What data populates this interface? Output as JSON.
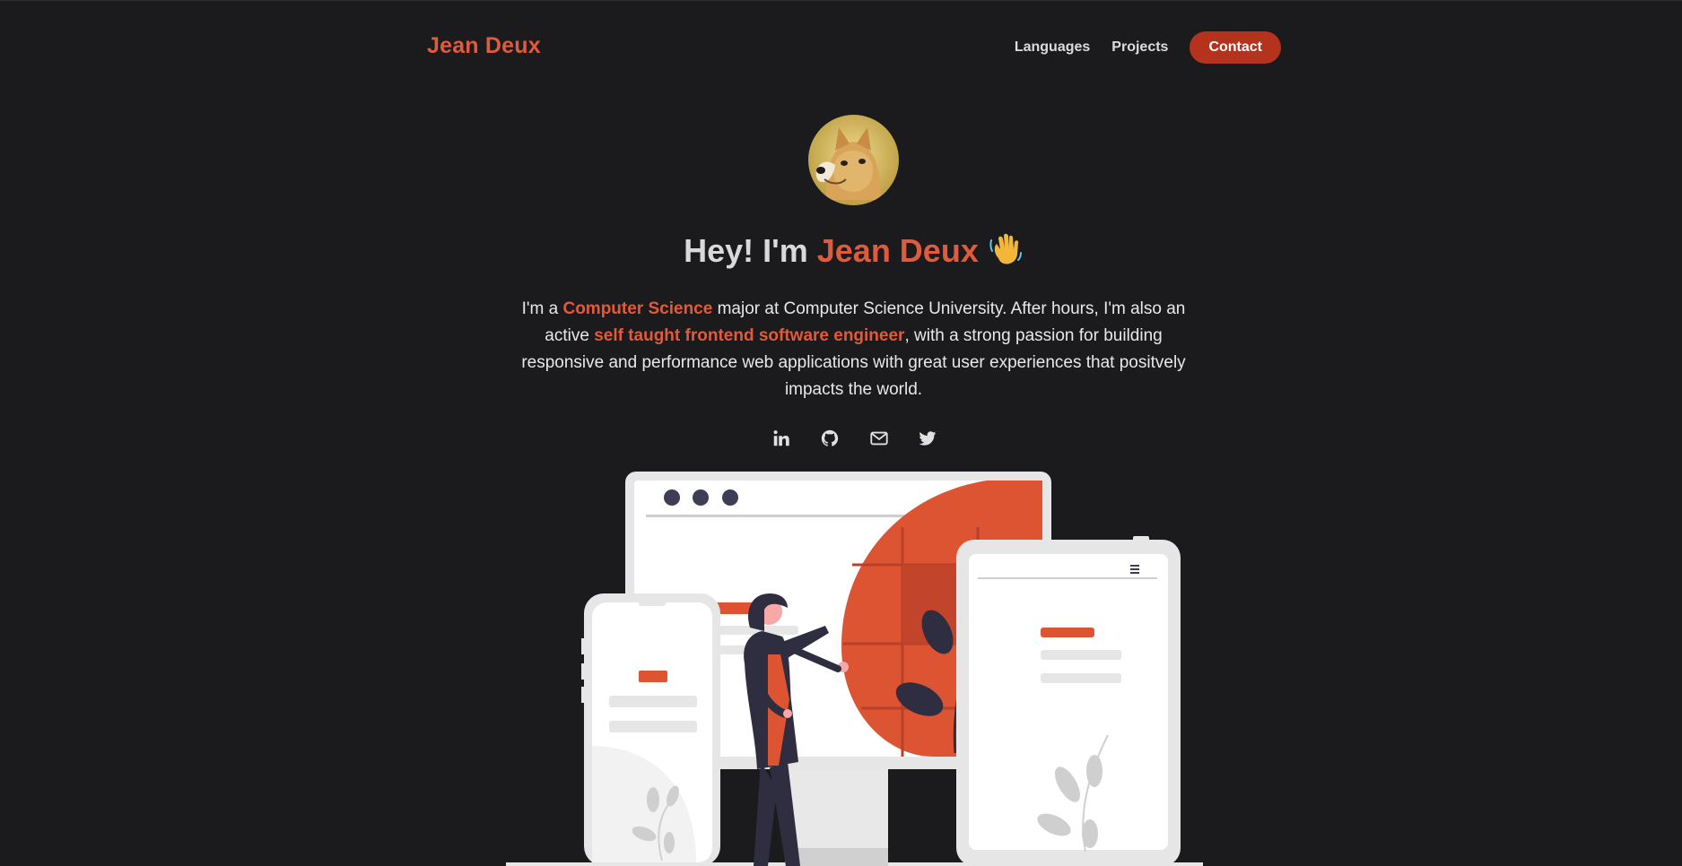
{
  "nav": {
    "brand": "Jean Deux",
    "links": [
      "Languages",
      "Projects"
    ],
    "contact_label": "Contact"
  },
  "hero": {
    "greeting": "Hey! I'm ",
    "name": "Jean Deux",
    "avatar_icon": "shiba-inu-avatar",
    "wave_icon": "waving-hand-icon"
  },
  "bio": {
    "part1": "I'm a ",
    "highlight1": "Computer Science",
    "part2": " major at Computer Science University. After hours, I'm also an active ",
    "highlight2": "self taught frontend software engineer",
    "part3": ", with a strong passion for building responsive and performance web applications with great user experiences that positvely impacts the world."
  },
  "socials": [
    {
      "icon": "linkedin-icon"
    },
    {
      "icon": "github-icon"
    },
    {
      "icon": "mail-icon"
    },
    {
      "icon": "twitter-icon"
    }
  ],
  "colors": {
    "accent": "#e05a3c",
    "button": "#b5321d",
    "background": "#1b1b1d"
  }
}
